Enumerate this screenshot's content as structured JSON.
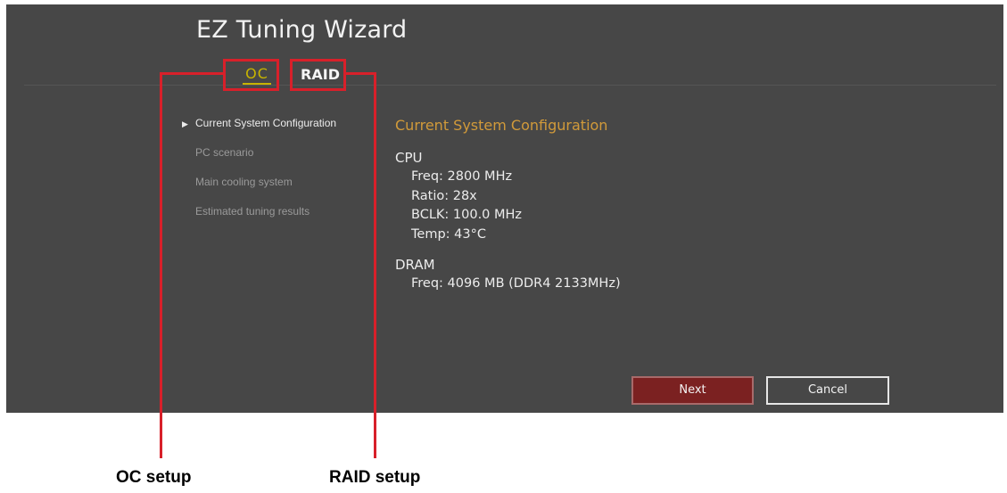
{
  "window": {
    "title": "EZ Tuning Wizard"
  },
  "tabs": [
    {
      "label": "OC",
      "active": true
    },
    {
      "label": "RAID",
      "active": false
    }
  ],
  "nav": {
    "items": [
      {
        "label": "Current System Configuration",
        "active": true
      },
      {
        "label": "PC scenario",
        "active": false
      },
      {
        "label": "Main cooling system",
        "active": false
      },
      {
        "label": "Estimated tuning results",
        "active": false
      }
    ],
    "active_marker_icon": "triangle-right-icon"
  },
  "content": {
    "heading": "Current System Configuration",
    "cpu": {
      "title": "CPU",
      "freq": "Freq: 2800 MHz",
      "ratio": "Ratio: 28x",
      "bclk": "BCLK: 100.0 MHz",
      "temp": "Temp: 43°C"
    },
    "dram": {
      "title": "DRAM",
      "freq": "Freq: 4096 MB (DDR4 2133MHz)"
    }
  },
  "buttons": {
    "next": "Next",
    "cancel": "Cancel"
  },
  "callouts": {
    "oc": "OC setup",
    "raid": "RAID setup"
  },
  "colors": {
    "screen_bg": "#474747",
    "active_tab": "#c8b400",
    "heading_accent": "#d19a3a",
    "callout_red": "#d8202a",
    "next_button": "#7b2121"
  }
}
